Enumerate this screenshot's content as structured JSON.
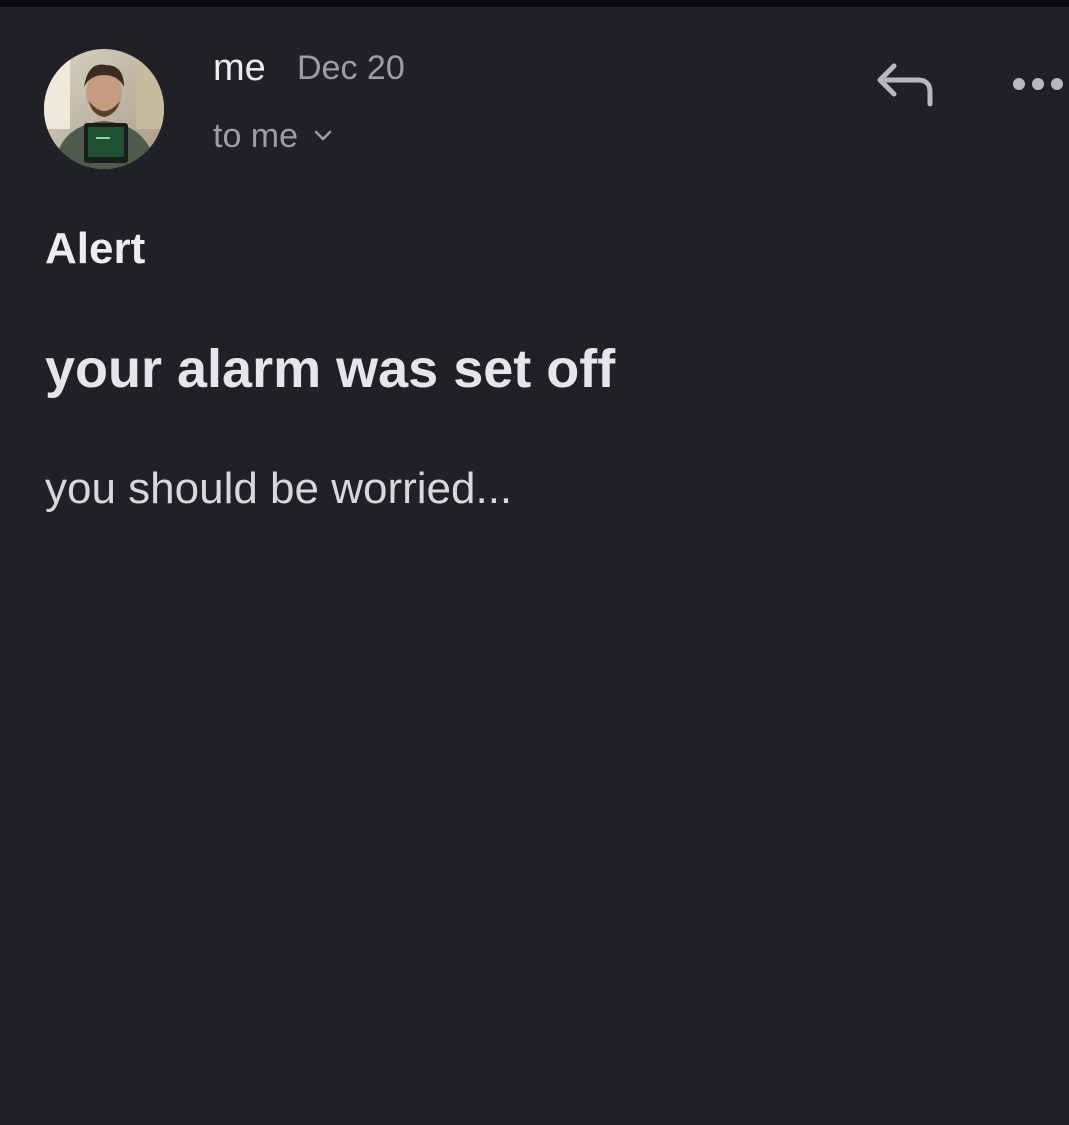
{
  "email": {
    "sender": "me",
    "date": "Dec 20",
    "recipients": "to me",
    "subject": "Alert",
    "headline": "your alarm was set off",
    "body": "you should be worried..."
  },
  "icons": {
    "avatar": "avatar-photo",
    "recipients_toggle": "chevron-down-icon",
    "reply": "reply-icon",
    "more": "more-options-icon"
  },
  "colors": {
    "background": "#202127",
    "primary_text": "#ececee",
    "secondary_text": "#9c9da3",
    "icon": "#b8b9be"
  }
}
